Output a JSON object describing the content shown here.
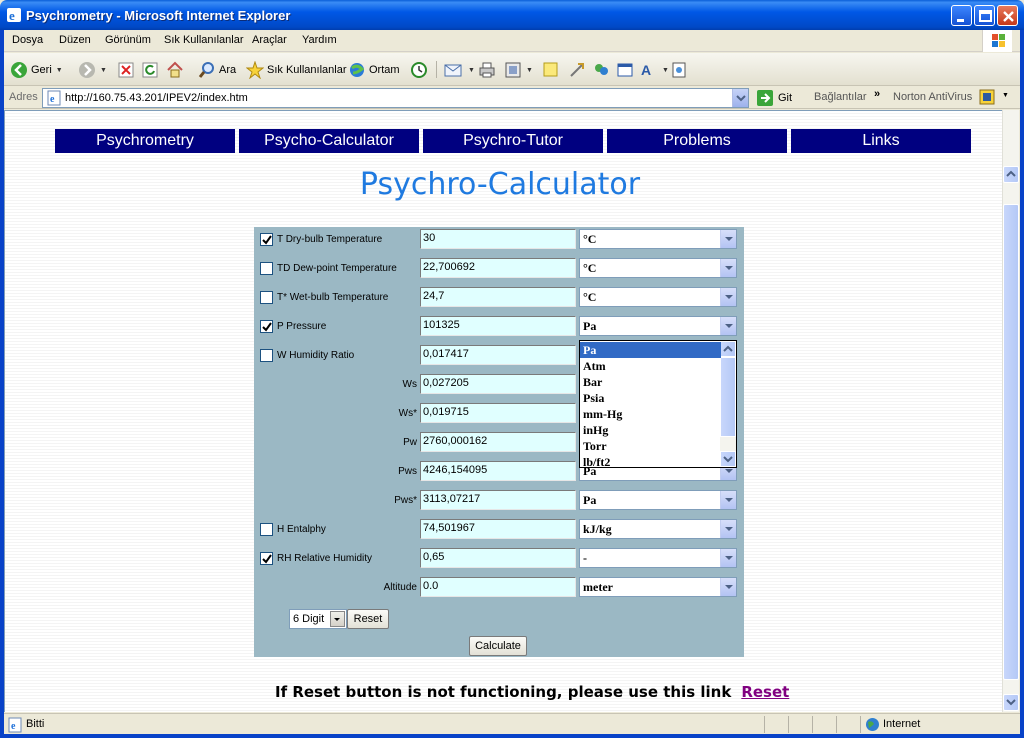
{
  "window": {
    "title": "Psychrometry - Microsoft Internet Explorer"
  },
  "menu": [
    "Dosya",
    "Düzen",
    "Görünüm",
    "Sık Kullanılanlar",
    "Araçlar",
    "Yardım"
  ],
  "toolbar": {
    "back": "Geri",
    "search": "Ara",
    "favorites": "Sık Kullanılanlar",
    "media": "Ortam"
  },
  "address": {
    "label": "Adres",
    "url": "http://160.75.43.201/IPEV2/index.htm",
    "go": "Git",
    "links": "Bağlantılar",
    "norton": "Norton AntiVirus"
  },
  "nav": [
    "Psychrometry",
    "Psycho-Calculator",
    "Psychro-Tutor",
    "Problems",
    "Links"
  ],
  "heading": "Psychro-Calculator",
  "rows": [
    {
      "checked": true,
      "label": "T  Dry-bulb Temperature",
      "value": "30",
      "unit": "°C"
    },
    {
      "checked": false,
      "label": "TD  Dew-point Temperature",
      "value": "22,700692",
      "unit": "°C"
    },
    {
      "checked": false,
      "label": "T*  Wet-bulb Temperature",
      "value": "24,7",
      "unit": "°C"
    },
    {
      "checked": true,
      "label": "P  Pressure",
      "value": "101325",
      "unit": "Pa"
    },
    {
      "checked": false,
      "label": "W  Humidity Ratio",
      "value": "0,017417",
      "unit": "-"
    },
    {
      "label": "Ws",
      "value": "0,027205",
      "unit": "-"
    },
    {
      "label": "Ws*",
      "value": "0,019715",
      "unit": "-"
    },
    {
      "label": "Pw",
      "value": "2760,000162",
      "unit": "Pa"
    },
    {
      "label": "Pws",
      "value": "4246,154095",
      "unit": "Pa"
    },
    {
      "label": "Pws*",
      "value": "3113,07217",
      "unit": "Pa"
    },
    {
      "checked": false,
      "label": "H  Entalphy",
      "value": "74,501967",
      "unit": "kJ/kg"
    },
    {
      "checked": true,
      "label": "RH  Relative Humidity",
      "value": "0,65",
      "unit": "-"
    },
    {
      "label": "Altitude",
      "value": "0.0",
      "unit": "meter"
    }
  ],
  "pressure_options": [
    "Pa",
    "Atm",
    "Bar",
    "Psia",
    "mm-Hg",
    "inHg",
    "Torr",
    "lb/ft2"
  ],
  "digits": "6 Digit",
  "reset_button": "Reset",
  "calculate_button": "Calculate",
  "reset_note": "If Reset button is not functioning, please use this link",
  "reset_link": "Reset",
  "status": {
    "text": "Bitti",
    "zone": "Internet"
  }
}
